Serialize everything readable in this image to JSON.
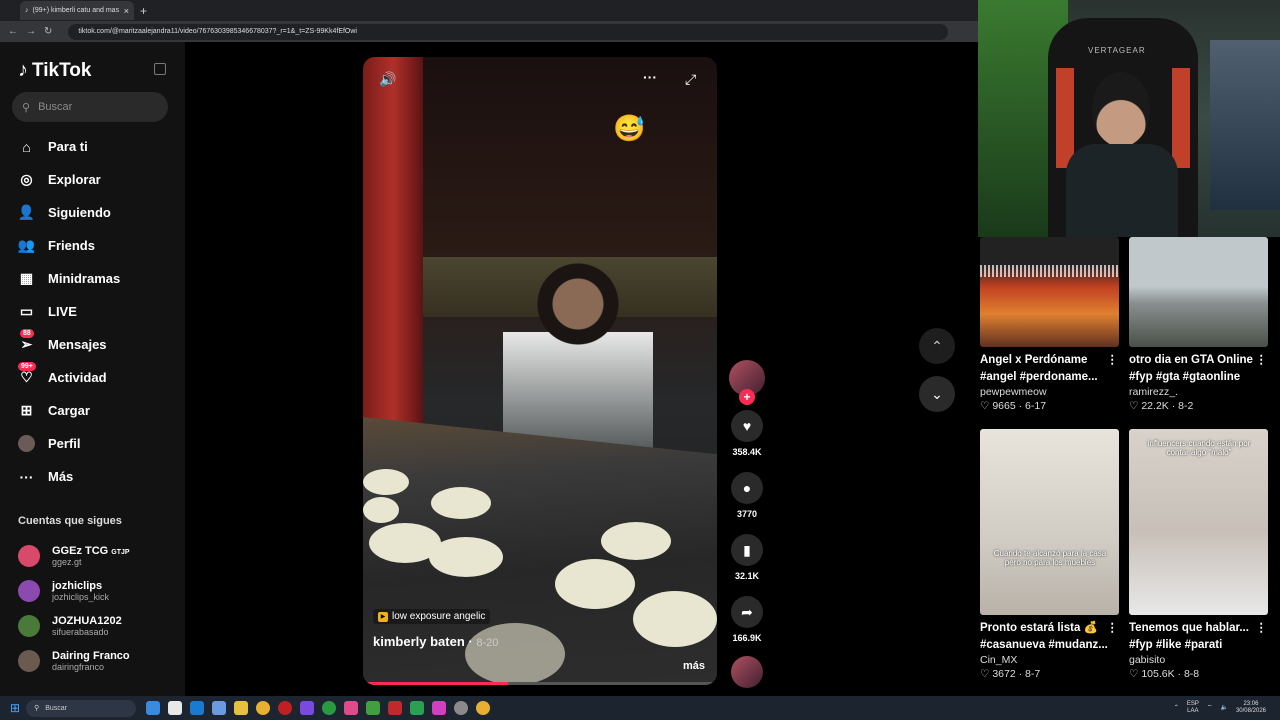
{
  "browser": {
    "tab_title": "(99+) kimberli catu and mas",
    "url": "tiktok.com/@maritzaalejandra11/video/7676303985346678037?_r=1&_t=ZS-99Kk4fEfOwi"
  },
  "sidebar": {
    "logo": "TikTok",
    "search_placeholder": "Buscar",
    "nav": [
      {
        "label": "Para ti",
        "icon": "home-icon"
      },
      {
        "label": "Explorar",
        "icon": "compass-icon"
      },
      {
        "label": "Siguiendo",
        "icon": "following-icon"
      },
      {
        "label": "Friends",
        "icon": "friends-icon"
      },
      {
        "label": "Minidramas",
        "icon": "film-icon"
      },
      {
        "label": "LIVE",
        "icon": "live-icon"
      },
      {
        "label": "Mensajes",
        "icon": "message-icon",
        "badge": "88"
      },
      {
        "label": "Actividad",
        "icon": "activity-icon",
        "badge": "99+"
      },
      {
        "label": "Cargar",
        "icon": "upload-icon"
      },
      {
        "label": "Perfil",
        "icon": "avatar"
      },
      {
        "label": "Más",
        "icon": "more-icon"
      }
    ],
    "following_title": "Cuentas que sigues",
    "following": [
      {
        "name": "GGEz TCG",
        "tag": "GTJP",
        "handle": "ggez.gt",
        "color": "#d84a6a"
      },
      {
        "name": "jozhiclips",
        "tag": "",
        "handle": "jozhiclips_kick",
        "color": "#8a4ab0"
      },
      {
        "name": "JOZHUA1202",
        "tag": "",
        "handle": "sifuerabasado",
        "color": "#4a7a3a"
      },
      {
        "name": "Dairing Franco",
        "tag": "",
        "handle": "dairingfranco",
        "color": "#6a5a50"
      }
    ]
  },
  "video": {
    "caption_tag": "low exposure angelic",
    "author": "kimberly baten",
    "date": "8-20",
    "more": "más",
    "progress": 0.41,
    "emoji": "😅"
  },
  "actions": [
    {
      "name": "like",
      "icon": "♥",
      "count": "358.4K"
    },
    {
      "name": "comment",
      "icon": "💬",
      "count": "3770"
    },
    {
      "name": "bookmark",
      "icon": "🔖",
      "count": "32.1K"
    },
    {
      "name": "share",
      "icon": "➦",
      "count": "166.9K"
    }
  ],
  "webcam": {
    "chair_brand": "VERTAGEAR"
  },
  "recommended": [
    {
      "title1": "Angel x Perdóname",
      "title2": "#angel #perdoname...",
      "user": "pewpewmeow",
      "likes": "9665",
      "date": "6-17"
    },
    {
      "title1": "otro dia en GTA Online",
      "title2": "#fyp #gta #gtaonline",
      "user": "ramirezz_.",
      "likes": "22.2K",
      "date": "8-2"
    },
    {
      "title1": "Pronto estará lista 💰",
      "title2": "#casanueva #mudanz...",
      "user": "Cin_MX",
      "likes": "3672",
      "date": "8-7",
      "overlay": "Cuando te alcanzó para la casa pero no para los muebles"
    },
    {
      "title1": "Tenemos que hablar...",
      "title2": "#fyp #like #parati",
      "user": "gabisito",
      "likes": "105.6K",
      "date": "8-8",
      "overlay": "influencers cuando están por contar algo \"malo\""
    }
  ],
  "taskbar": {
    "search": "Buscar",
    "lang1": "ESP",
    "lang2": "LAA",
    "time": "23:06",
    "date": "30/08/2026"
  }
}
